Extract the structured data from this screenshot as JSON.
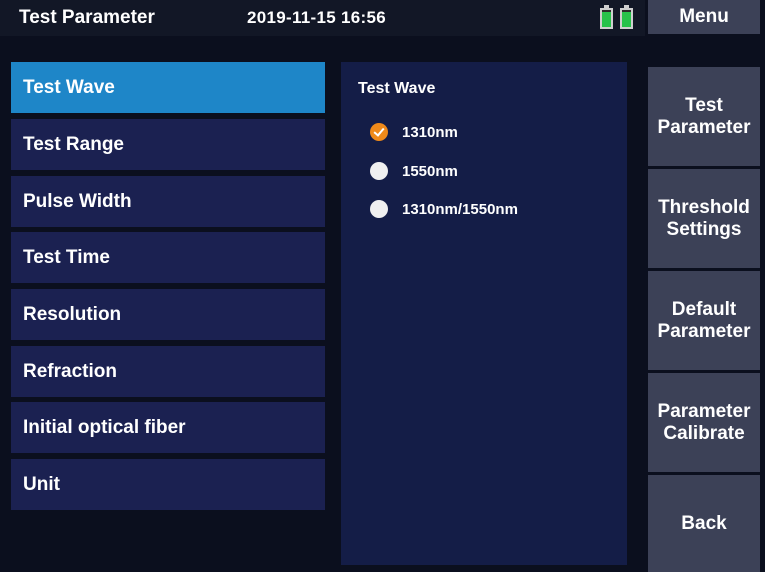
{
  "header": {
    "title": "Test Parameter",
    "datetime": "2019-11-15 16:56",
    "battery_icons": [
      "battery-icon",
      "battery-icon"
    ],
    "battery_color": "#27c24a"
  },
  "menu_button": {
    "label": "Menu"
  },
  "param_list": {
    "items": [
      {
        "label": "Test Wave",
        "selected": true
      },
      {
        "label": "Test Range",
        "selected": false
      },
      {
        "label": "Pulse Width",
        "selected": false
      },
      {
        "label": "Test Time",
        "selected": false
      },
      {
        "label": "Resolution",
        "selected": false
      },
      {
        "label": "Refraction",
        "selected": false
      },
      {
        "label": "Initial optical fiber",
        "selected": false
      },
      {
        "label": "Unit",
        "selected": false
      }
    ]
  },
  "panel": {
    "title": "Test Wave",
    "options": [
      {
        "label": "1310nm",
        "checked": true
      },
      {
        "label": "1550nm",
        "checked": false
      },
      {
        "label": "1310nm/1550nm",
        "checked": false
      }
    ]
  },
  "side_buttons": [
    {
      "line1": "Test",
      "line2": "Parameter"
    },
    {
      "line1": "Threshold",
      "line2": "Settings"
    },
    {
      "line1": "Default",
      "line2": "Parameter"
    },
    {
      "line1": "Parameter",
      "line2": "Calibrate"
    },
    {
      "line1": "Back",
      "line2": ""
    }
  ],
  "colors": {
    "background": "#0b0f1e",
    "selected_item": "#1e86c8",
    "item": "#1b2151",
    "panel": "#141d47",
    "side_button": "#3c4157",
    "radio_checked": "#f08a1a"
  }
}
